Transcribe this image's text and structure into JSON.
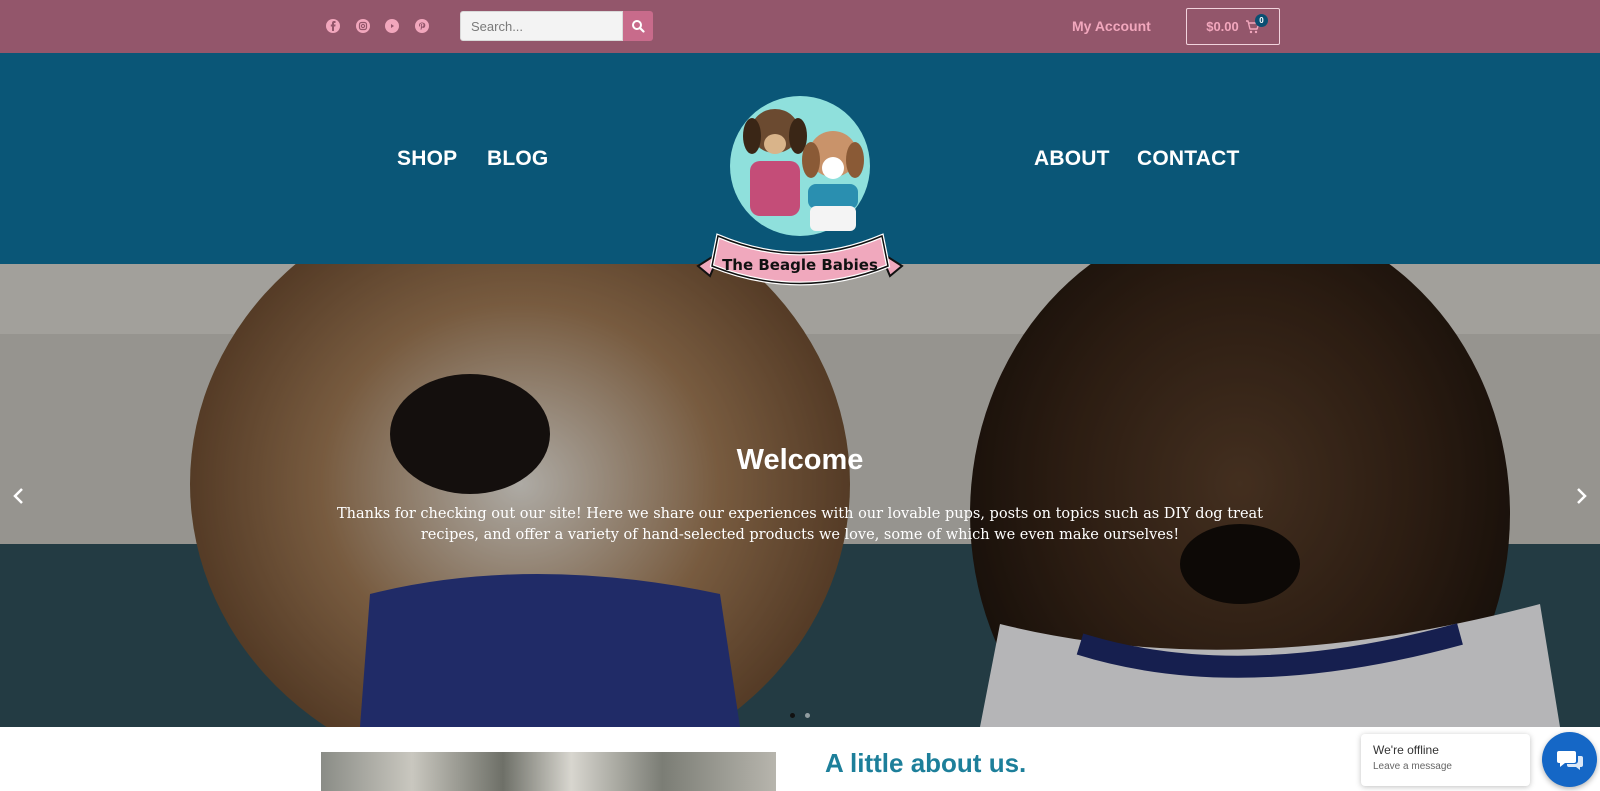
{
  "topbar": {
    "social_icons": [
      "facebook-icon",
      "instagram-icon",
      "youtube-icon",
      "pinterest-icon"
    ],
    "search": {
      "placeholder": "Search..."
    },
    "my_account": "My Account",
    "cart": {
      "total": "$0.00",
      "count": "0"
    }
  },
  "nav": {
    "left": [
      "SHOP",
      "BLOG"
    ],
    "right": [
      "ABOUT",
      "CONTACT"
    ]
  },
  "logo": {
    "text": "The Beagle Babies"
  },
  "hero": {
    "title": "Welcome",
    "text": "Thanks for checking out our site! Here we share our experiences with our lovable pups, posts on topics such as DIY dog treat recipes, and offer a variety of hand-selected products we love, some of which we even make ourselves!",
    "slide_count": 2,
    "active_slide": 1
  },
  "about": {
    "heading": "A little about us."
  },
  "chat": {
    "status": "We're offline",
    "action": "Leave a message"
  },
  "colors": {
    "topbar": "#93566b",
    "nav": "#0a5677",
    "accent_pink": "#f2a7bd",
    "heading_teal": "#1d7f9a",
    "chat_blue": "#1567c6"
  }
}
